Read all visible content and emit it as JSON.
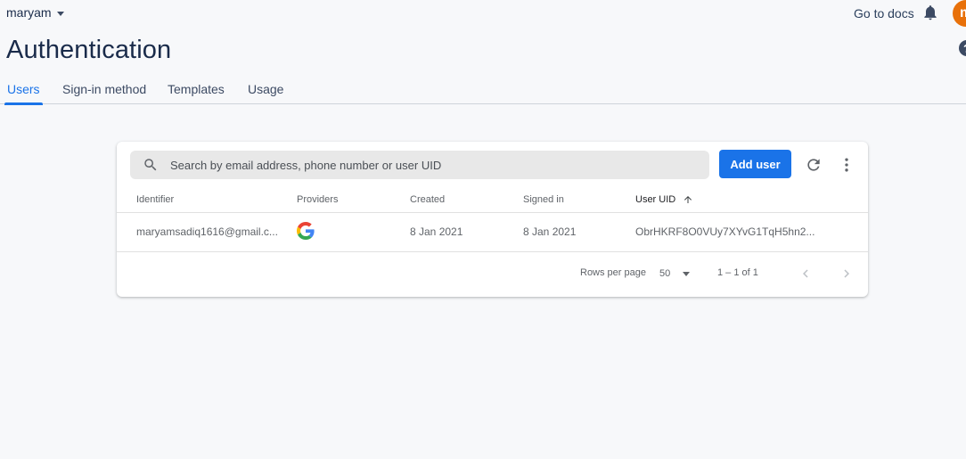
{
  "topbar": {
    "project_name": "maryam",
    "docs_label": "Go to docs",
    "avatar_initial": "m",
    "avatar_color": "#e8710a"
  },
  "page": {
    "title": "Authentication",
    "help_label": "?"
  },
  "tabs": [
    {
      "label": "Users",
      "active": true
    },
    {
      "label": "Sign-in method",
      "active": false
    },
    {
      "label": "Templates",
      "active": false
    },
    {
      "label": "Usage",
      "active": false
    }
  ],
  "users_card": {
    "search": {
      "icon": "search-icon",
      "placeholder": "Search by email address, phone number or user UID",
      "value": ""
    },
    "add_user_label": "Add user",
    "refresh_icon": "refresh-icon",
    "more_icon": "more-vert-icon",
    "columns": [
      "Identifier",
      "Providers",
      "Created",
      "Signed in",
      "User UID"
    ],
    "sorted_column": "User UID",
    "sort_icon": "arrow-up-icon",
    "rows": [
      {
        "identifier": "maryamsadiq1616@gmail.c...",
        "provider_icon": "google-icon",
        "created": "8 Jan 2021",
        "signed_in": "8 Jan 2021",
        "uid": "ObrHKRF8O0VUy7XYvG1TqH5hn2..."
      }
    ],
    "pagination": {
      "rows_per_page_label": "Rows per page",
      "rows_per_page_value": "50",
      "range_label": "1 – 1 of 1"
    }
  },
  "colors": {
    "accent": "#1a73e8",
    "background": "#f7f8fa"
  }
}
